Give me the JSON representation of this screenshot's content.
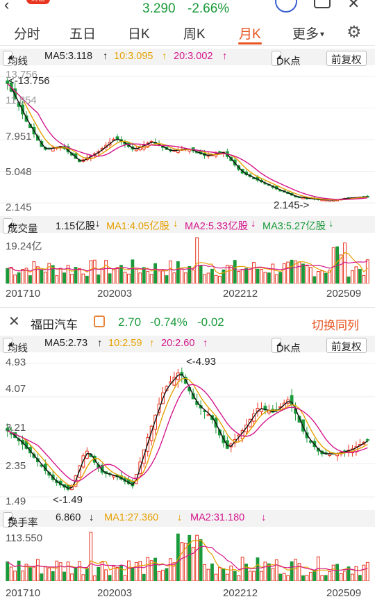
{
  "header": {
    "price": "3.290",
    "change_pct": "-2.66%",
    "logo_text": "财富"
  },
  "tabs": [
    "分时",
    "五日",
    "日K",
    "周K",
    "月K",
    "更多"
  ],
  "chart1": {
    "ma_toggle": "均线",
    "ma5": "MA5:3.118",
    "ma10": "10:3.095",
    "ma20": "20:3.002",
    "dk": "DK点",
    "fq": "前复权",
    "prices": [
      "13.756",
      "11.854",
      "7.951",
      "5.048",
      "2.145"
    ],
    "high_note": "<-13.756",
    "low_note": "2.145->",
    "vol_label": "成交量",
    "vol_val": "1.15亿股",
    "vol_ma1": "MA1:4.05亿股",
    "vol_ma2": "MA2:5.33亿股",
    "vol_ma3": "MA3:5.27亿股",
    "vol_max": "19.24亿",
    "dates": [
      "201710",
      "202003",
      "202212",
      "202509"
    ]
  },
  "chart2": {
    "stock_name": "福田汽车",
    "price": "2.70",
    "pct": "-0.74%",
    "chg": "-0.02",
    "switch_label": "切换同列",
    "ma_toggle": "均线",
    "ma5": "MA5:2.73",
    "ma10": "10:2.59",
    "ma20": "20:2.60",
    "dk": "DK点",
    "fq": "前复权",
    "prices": [
      "4.93",
      "4.07",
      "3.21",
      "2.35",
      "1.49"
    ],
    "high_note": "<-4.93",
    "low_note": "<-1.49",
    "turn_label": "换手率",
    "turn_val": "6.860",
    "turn_ma1": "MA1:27.360",
    "turn_ma2": "MA2:31.180",
    "turn_max": "113.550",
    "dates": [
      "201710",
      "202003",
      "202212",
      "202509"
    ]
  },
  "colors": {
    "up": "#e8331f",
    "down": "#1a9a3a",
    "accent": "#e8541e",
    "ma5": "#111111",
    "ma10": "#e5a000",
    "ma20": "#d4168c"
  },
  "icons": [
    "back-arrow-icon",
    "search-icon",
    "more-icon",
    "settings-icon",
    "close-icon",
    "lock-icon",
    "lock-icon-2"
  ]
}
